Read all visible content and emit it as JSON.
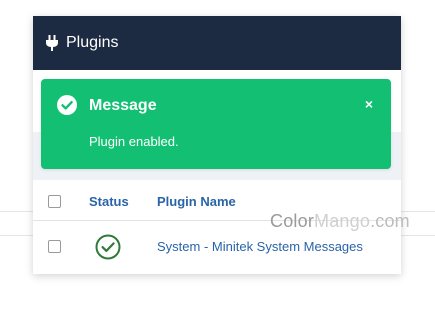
{
  "header": {
    "title": "Plugins",
    "icon": "plug-icon"
  },
  "alert": {
    "title": "Message",
    "body": "Plugin enabled.",
    "close_label": "×",
    "color": "#13c073",
    "icon": "check-circle-icon"
  },
  "table": {
    "columns": [
      "Status",
      "Plugin Name"
    ],
    "rows": [
      {
        "status": "enabled",
        "status_icon": "check-circle-icon",
        "name": "System - Minitek System Messages"
      }
    ]
  },
  "watermark": {
    "part1": "Color",
    "part2": "Mango",
    "part3": ".com"
  },
  "colors": {
    "header_bg": "#1c2a42",
    "link": "#2a64a8",
    "enabled": "#2f7a3b"
  }
}
